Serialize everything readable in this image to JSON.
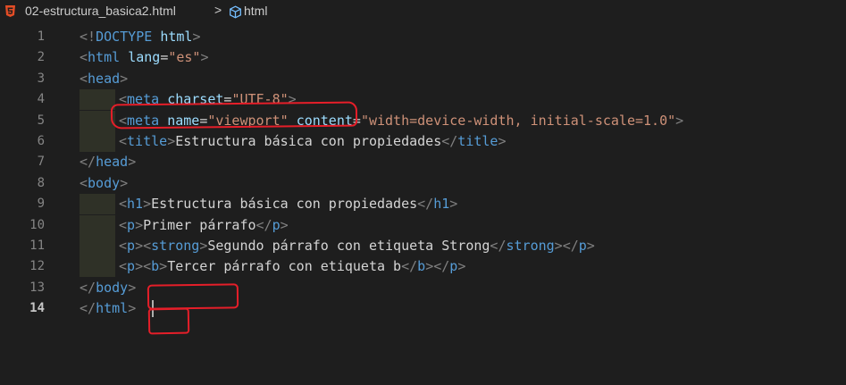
{
  "breadcrumb": {
    "file_name": "02-estructura_basica2.html",
    "separator": ">",
    "symbol": "html"
  },
  "colors": {
    "background": "#1e1e1e",
    "tag": "#569cd6",
    "attribute": "#9cdcfe",
    "string": "#ce9178",
    "text": "#d4d4d4",
    "punctuation": "#808080",
    "line_number": "#858585",
    "annotation_red": "#e51e29"
  },
  "editor": {
    "active_line": 14,
    "lines": [
      {
        "number": "1",
        "tokens": [
          [
            "p",
            "<!"
          ],
          [
            "t",
            "DOCTYPE"
          ],
          [
            "x",
            " "
          ],
          [
            "a",
            "html"
          ],
          [
            "p",
            ">"
          ]
        ]
      },
      {
        "number": "2",
        "tokens": [
          [
            "p",
            "<"
          ],
          [
            "t",
            "html"
          ],
          [
            "x",
            " "
          ],
          [
            "a",
            "lang"
          ],
          [
            "x",
            "="
          ],
          [
            "s",
            "\"es\""
          ],
          [
            "p",
            ">"
          ]
        ]
      },
      {
        "number": "3",
        "tokens": [
          [
            "p",
            "<"
          ],
          [
            "t",
            "head"
          ],
          [
            "p",
            ">"
          ]
        ]
      },
      {
        "number": "4",
        "tokens": [
          [
            "p",
            "<"
          ],
          [
            "t",
            "meta"
          ],
          [
            "x",
            " "
          ],
          [
            "a",
            "charset"
          ],
          [
            "x",
            "="
          ],
          [
            "s",
            "\"UTF-8\""
          ],
          [
            "p",
            ">"
          ]
        ]
      },
      {
        "number": "5",
        "tokens": [
          [
            "p",
            "<"
          ],
          [
            "t",
            "meta"
          ],
          [
            "x",
            " "
          ],
          [
            "a",
            "name"
          ],
          [
            "x",
            "="
          ],
          [
            "s",
            "\"viewport\""
          ],
          [
            "x",
            " "
          ],
          [
            "a",
            "content"
          ],
          [
            "x",
            "="
          ],
          [
            "s",
            "\"width=device-width, initial-scale=1.0\""
          ],
          [
            "p",
            ">"
          ]
        ]
      },
      {
        "number": "6",
        "tokens": [
          [
            "p",
            "<"
          ],
          [
            "t",
            "title"
          ],
          [
            "p",
            ">"
          ],
          [
            "x",
            "Estructura básica con propiedades"
          ],
          [
            "p",
            "</"
          ],
          [
            "t",
            "title"
          ],
          [
            "p",
            ">"
          ]
        ]
      },
      {
        "number": "7",
        "tokens": [
          [
            "p",
            "</"
          ],
          [
            "t",
            "head"
          ],
          [
            "p",
            ">"
          ]
        ]
      },
      {
        "number": "8",
        "tokens": [
          [
            "p",
            "<"
          ],
          [
            "t",
            "body"
          ],
          [
            "p",
            ">"
          ]
        ]
      },
      {
        "number": "9",
        "tokens": [
          [
            "p",
            "<"
          ],
          [
            "t",
            "h1"
          ],
          [
            "p",
            ">"
          ],
          [
            "x",
            "Estructura básica con propiedades"
          ],
          [
            "p",
            "</"
          ],
          [
            "t",
            "h1"
          ],
          [
            "p",
            ">"
          ]
        ]
      },
      {
        "number": "10",
        "tokens": [
          [
            "p",
            "<"
          ],
          [
            "t",
            "p"
          ],
          [
            "p",
            ">"
          ],
          [
            "x",
            "Primer párrafo"
          ],
          [
            "p",
            "</"
          ],
          [
            "t",
            "p"
          ],
          [
            "p",
            ">"
          ]
        ]
      },
      {
        "number": "11",
        "tokens": [
          [
            "p",
            "<"
          ],
          [
            "t",
            "p"
          ],
          [
            "p",
            ">"
          ],
          [
            "p",
            "<"
          ],
          [
            "t",
            "strong"
          ],
          [
            "p",
            ">"
          ],
          [
            "x",
            "Segundo párrafo con etiqueta Strong"
          ],
          [
            "p",
            "</"
          ],
          [
            "t",
            "strong"
          ],
          [
            "p",
            ">"
          ],
          [
            "p",
            "</"
          ],
          [
            "t",
            "p"
          ],
          [
            "p",
            ">"
          ]
        ]
      },
      {
        "number": "12",
        "tokens": [
          [
            "p",
            "<"
          ],
          [
            "t",
            "p"
          ],
          [
            "p",
            ">"
          ],
          [
            "p",
            "<"
          ],
          [
            "t",
            "b"
          ],
          [
            "p",
            ">"
          ],
          [
            "x",
            "Tercer párrafo con etiqueta b"
          ],
          [
            "p",
            "</"
          ],
          [
            "t",
            "b"
          ],
          [
            "p",
            ">"
          ],
          [
            "p",
            "</"
          ],
          [
            "t",
            "p"
          ],
          [
            "p",
            ">"
          ]
        ]
      },
      {
        "number": "13",
        "tokens": [
          [
            "p",
            "</"
          ],
          [
            "t",
            "body"
          ],
          [
            "p",
            ">"
          ]
        ]
      },
      {
        "number": "14",
        "tokens": [
          [
            "p",
            "</"
          ],
          [
            "t",
            "html"
          ],
          [
            "p",
            ">"
          ]
        ]
      }
    ]
  }
}
